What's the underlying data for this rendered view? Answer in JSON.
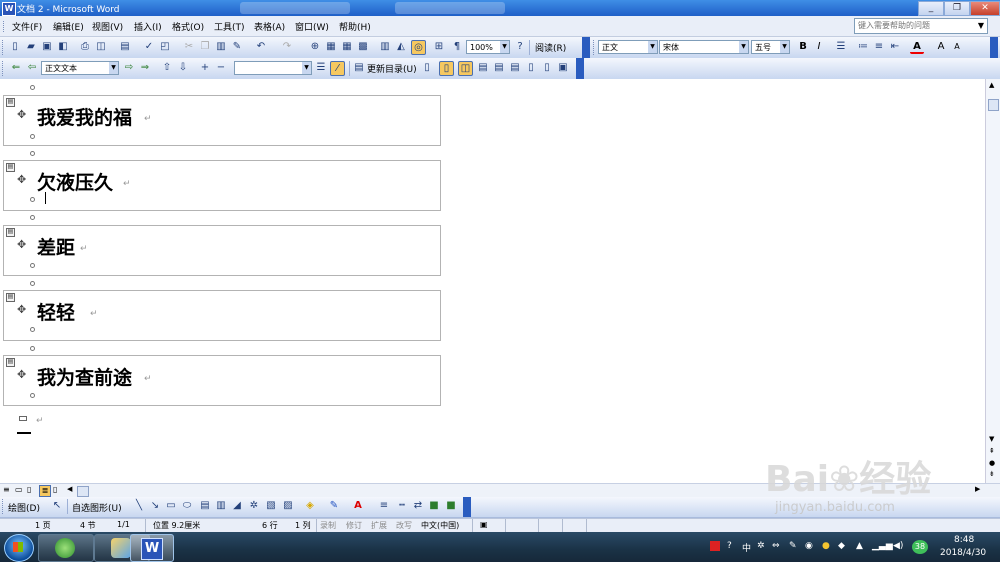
{
  "window": {
    "title": "文档 2 - Microsoft Word",
    "minimize_label": "_",
    "restore_label": "❐",
    "close_label": "✕"
  },
  "menu": {
    "items": [
      "文件(F)",
      "编辑(E)",
      "视图(V)",
      "插入(I)",
      "格式(O)",
      "工具(T)",
      "表格(A)",
      "窗口(W)",
      "帮助(H)"
    ],
    "help_placeholder": "键入需要帮助的问题"
  },
  "standard_toolbar": {
    "zoom": "100%",
    "read_label": "阅读(R)"
  },
  "formatting_toolbar": {
    "style": "正文",
    "font": "宋体",
    "size": "五号",
    "bold": "B",
    "italic": "I"
  },
  "outline_toolbar": {
    "level": "正文文本",
    "show_level": "",
    "update_toc_label": "更新目录(U)"
  },
  "document": {
    "headings": [
      "我爱我的福",
      "欠液压久",
      "差距",
      "轻轻",
      "我为查前途"
    ],
    "return_mark": "↵"
  },
  "drawing_toolbar": {
    "draw_label": "绘图(D)",
    "autoshape_label": "自选图形(U)"
  },
  "status_bar": {
    "page": "1 页",
    "section": "4 节",
    "page_of": "1/1",
    "position": "位置 9.2厘米",
    "line": "6 行",
    "column": "1 列",
    "rec": "录制",
    "trk": "修订",
    "ext": "扩展",
    "ovr": "改写",
    "language": "中文(中国)"
  },
  "taskbar": {
    "time": "8:48",
    "date": "2018/4/30",
    "tray_badge": "38",
    "ime": "中"
  },
  "watermark": {
    "brand": "Bai",
    "brand2": "经验",
    "url": "jingyan.baidu.com"
  }
}
